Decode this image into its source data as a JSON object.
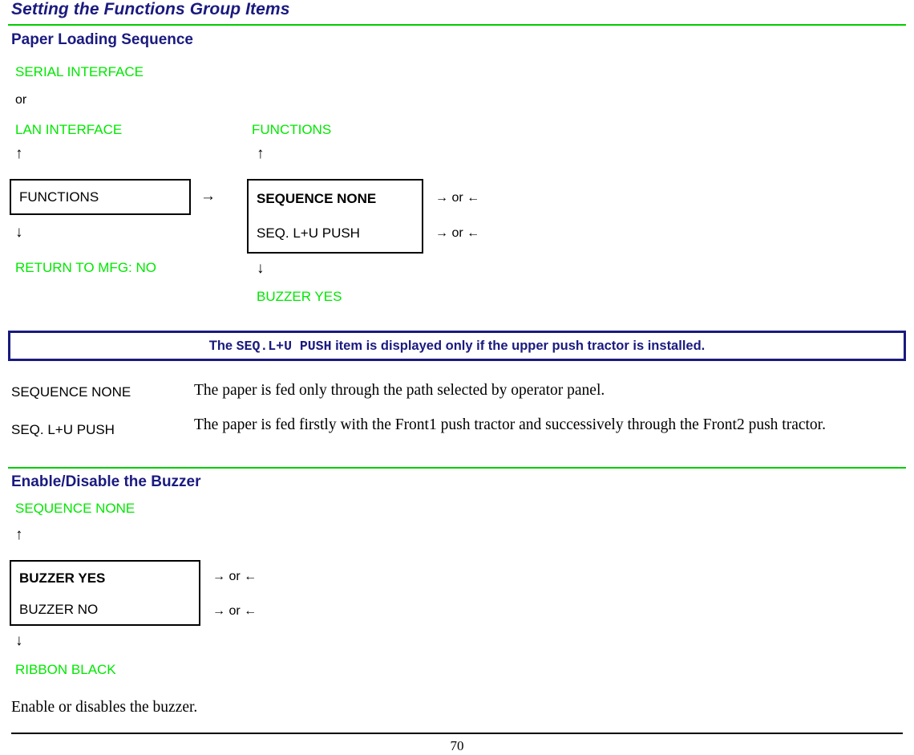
{
  "document": {
    "title": "Setting the Functions Group Items",
    "page_number": "70"
  },
  "sections": [
    {
      "id": "paper-loading-sequence",
      "heading": "Paper Loading Sequence",
      "diagram": {
        "left_column": {
          "above_labels": [
            "SERIAL INTERFACE",
            "LAN INTERFACE"
          ],
          "or_text": "or",
          "up_arrow": "↑",
          "box_lines": [
            "FUNCTIONS"
          ],
          "down_arrow": "↓",
          "below_label": "RETURN TO MFG: NO"
        },
        "right_column": {
          "above_label": "FUNCTIONS",
          "up_arrow": "↑",
          "box_lines": [
            "SEQUENCE NONE",
            "SEQ. L+U  PUSH"
          ],
          "side_hints": [
            "→ or ←",
            "→ or ←"
          ],
          "down_arrow": "↓",
          "below_label": "BUZZER YES"
        },
        "connector_arrow": "→"
      },
      "note": {
        "prefix": "The ",
        "code": "SEQ.L+U PUSH",
        "suffix": " item is displayed only if the upper push tractor is installed."
      },
      "descriptions": [
        {
          "term": "SEQUENCE NONE",
          "text": "The paper is fed only through the path selected by operator panel."
        },
        {
          "term": "SEQ. L+U PUSH",
          "text": "The paper is fed firstly with the Front1 push tractor and successively through the Front2 push tractor."
        }
      ]
    },
    {
      "id": "enable-disable-buzzer",
      "heading": "Enable/Disable the Buzzer",
      "diagram": {
        "above_label": "SEQUENCE NONE",
        "up_arrow": "↑",
        "box_lines": [
          "BUZZER YES",
          "BUZZER NO"
        ],
        "side_hints": [
          "→ or ←",
          "→ or ←"
        ],
        "down_arrow": "↓",
        "below_label": "RIBBON BLACK"
      },
      "paragraph": "Enable or disables the buzzer."
    }
  ],
  "colors": {
    "heading": "#1a1a80",
    "menu_green": "#00e800",
    "rule_green": "#00cc00",
    "text": "#000000"
  }
}
